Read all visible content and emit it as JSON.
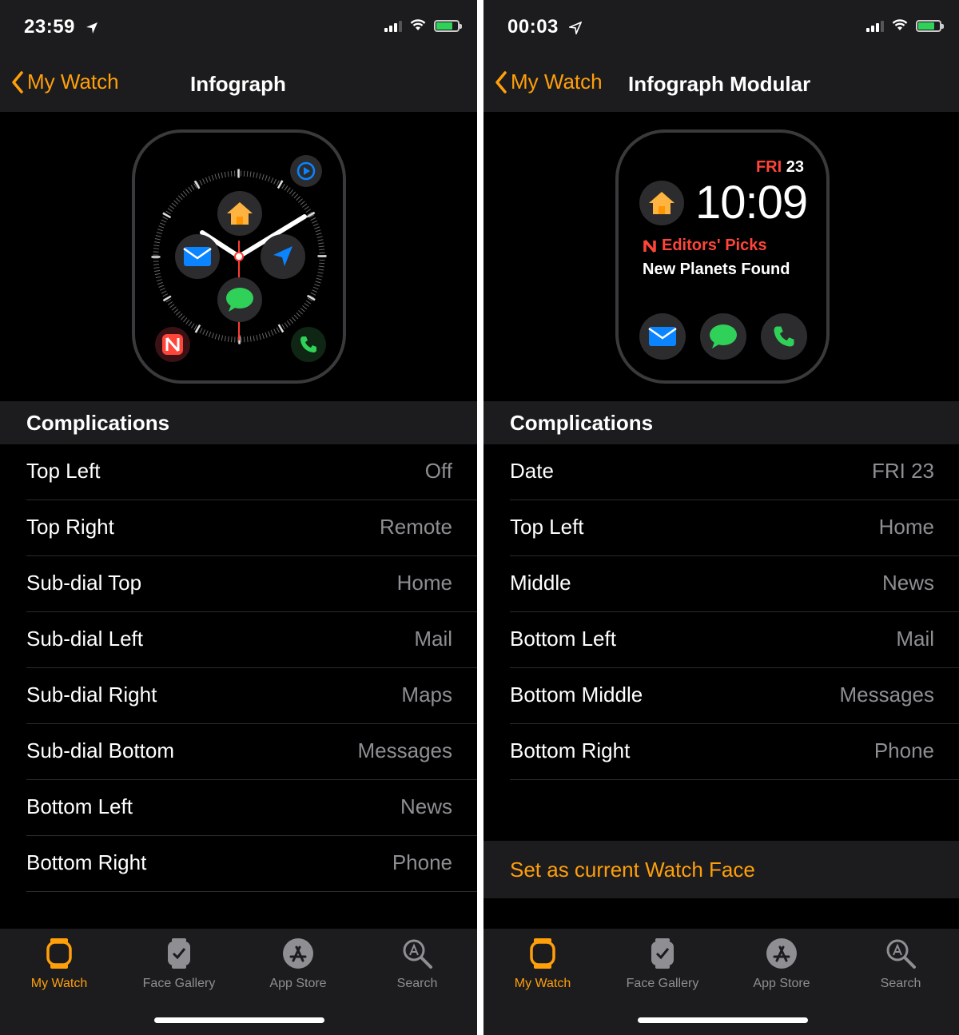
{
  "left": {
    "status": {
      "time": "23:59",
      "battery_percent": 70
    },
    "nav": {
      "back_label": "My Watch",
      "title": "Infograph"
    },
    "section_title": "Complications",
    "rows": [
      {
        "label": "Top Left",
        "value": "Off"
      },
      {
        "label": "Top Right",
        "value": "Remote"
      },
      {
        "label": "Sub-dial Top",
        "value": "Home"
      },
      {
        "label": "Sub-dial Left",
        "value": "Mail"
      },
      {
        "label": "Sub-dial Right",
        "value": "Maps"
      },
      {
        "label": "Sub-dial Bottom",
        "value": "Messages"
      },
      {
        "label": "Bottom Left",
        "value": "News"
      },
      {
        "label": "Bottom Right",
        "value": "Phone"
      }
    ]
  },
  "right": {
    "status": {
      "time": "00:03",
      "battery_percent": 70
    },
    "nav": {
      "back_label": "My Watch",
      "title": "Infograph Modular"
    },
    "watch_face": {
      "day": "FRI",
      "date": "23",
      "time": "10:09",
      "news_title": "Editors' Picks",
      "news_headline": "New Planets Found"
    },
    "section_title": "Complications",
    "rows": [
      {
        "label": "Date",
        "value": "FRI 23"
      },
      {
        "label": "Top Left",
        "value": "Home"
      },
      {
        "label": "Middle",
        "value": "News"
      },
      {
        "label": "Bottom Left",
        "value": "Mail"
      },
      {
        "label": "Bottom Middle",
        "value": "Messages"
      },
      {
        "label": "Bottom Right",
        "value": "Phone"
      }
    ],
    "action_label": "Set as current Watch Face"
  },
  "tabs": [
    {
      "label": "My Watch",
      "icon": "watch-icon",
      "active": true
    },
    {
      "label": "Face Gallery",
      "icon": "face-gallery-icon",
      "active": false
    },
    {
      "label": "App Store",
      "icon": "app-store-icon",
      "active": false
    },
    {
      "label": "Search",
      "icon": "search-icon",
      "active": false
    }
  ],
  "colors": {
    "accent": "#ff9f0a",
    "background": "#000000",
    "bar": "#1c1c1e",
    "secondary_text": "#8e8e93",
    "news_red": "#ff453a",
    "messages_green": "#30d158",
    "mail_blue": "#0a84ff"
  }
}
